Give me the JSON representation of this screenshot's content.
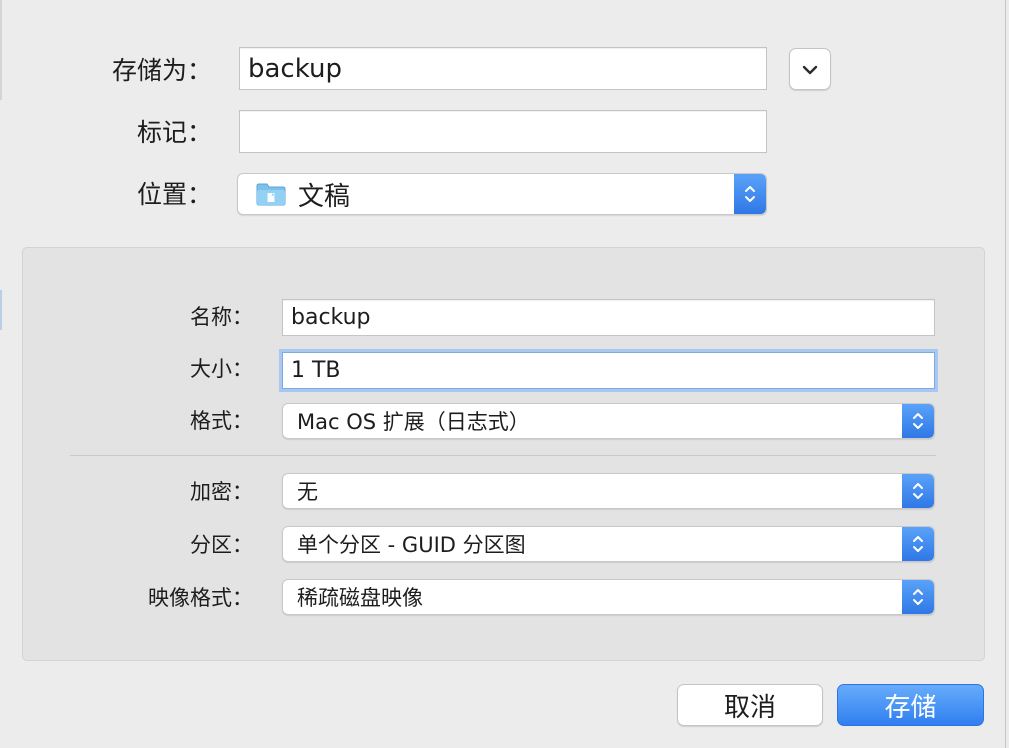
{
  "save_as": {
    "label": "存储为：",
    "value": "backup"
  },
  "tags": {
    "label": "标记：",
    "value": ""
  },
  "location": {
    "label": "位置：",
    "value": "文稿"
  },
  "image_options": {
    "name": {
      "label": "名称：",
      "value": "backup"
    },
    "size": {
      "label": "大小：",
      "value": "1 TB"
    },
    "format": {
      "label": "格式：",
      "value": "Mac OS 扩展（日志式）"
    },
    "encryption": {
      "label": "加密：",
      "value": "无"
    },
    "partitions": {
      "label": "分区：",
      "value": "单个分区 - GUID 分区图"
    },
    "image_format": {
      "label": "映像格式：",
      "value": "稀疏磁盘映像"
    }
  },
  "buttons": {
    "cancel": "取消",
    "save": "存储"
  },
  "colors": {
    "accent": "#2f7ff0",
    "focus_ring": "#a9c8f1"
  },
  "icons": {
    "expand": "chevron-down-icon",
    "folder": "folder-icon",
    "popup": "up-down-arrows-icon"
  }
}
